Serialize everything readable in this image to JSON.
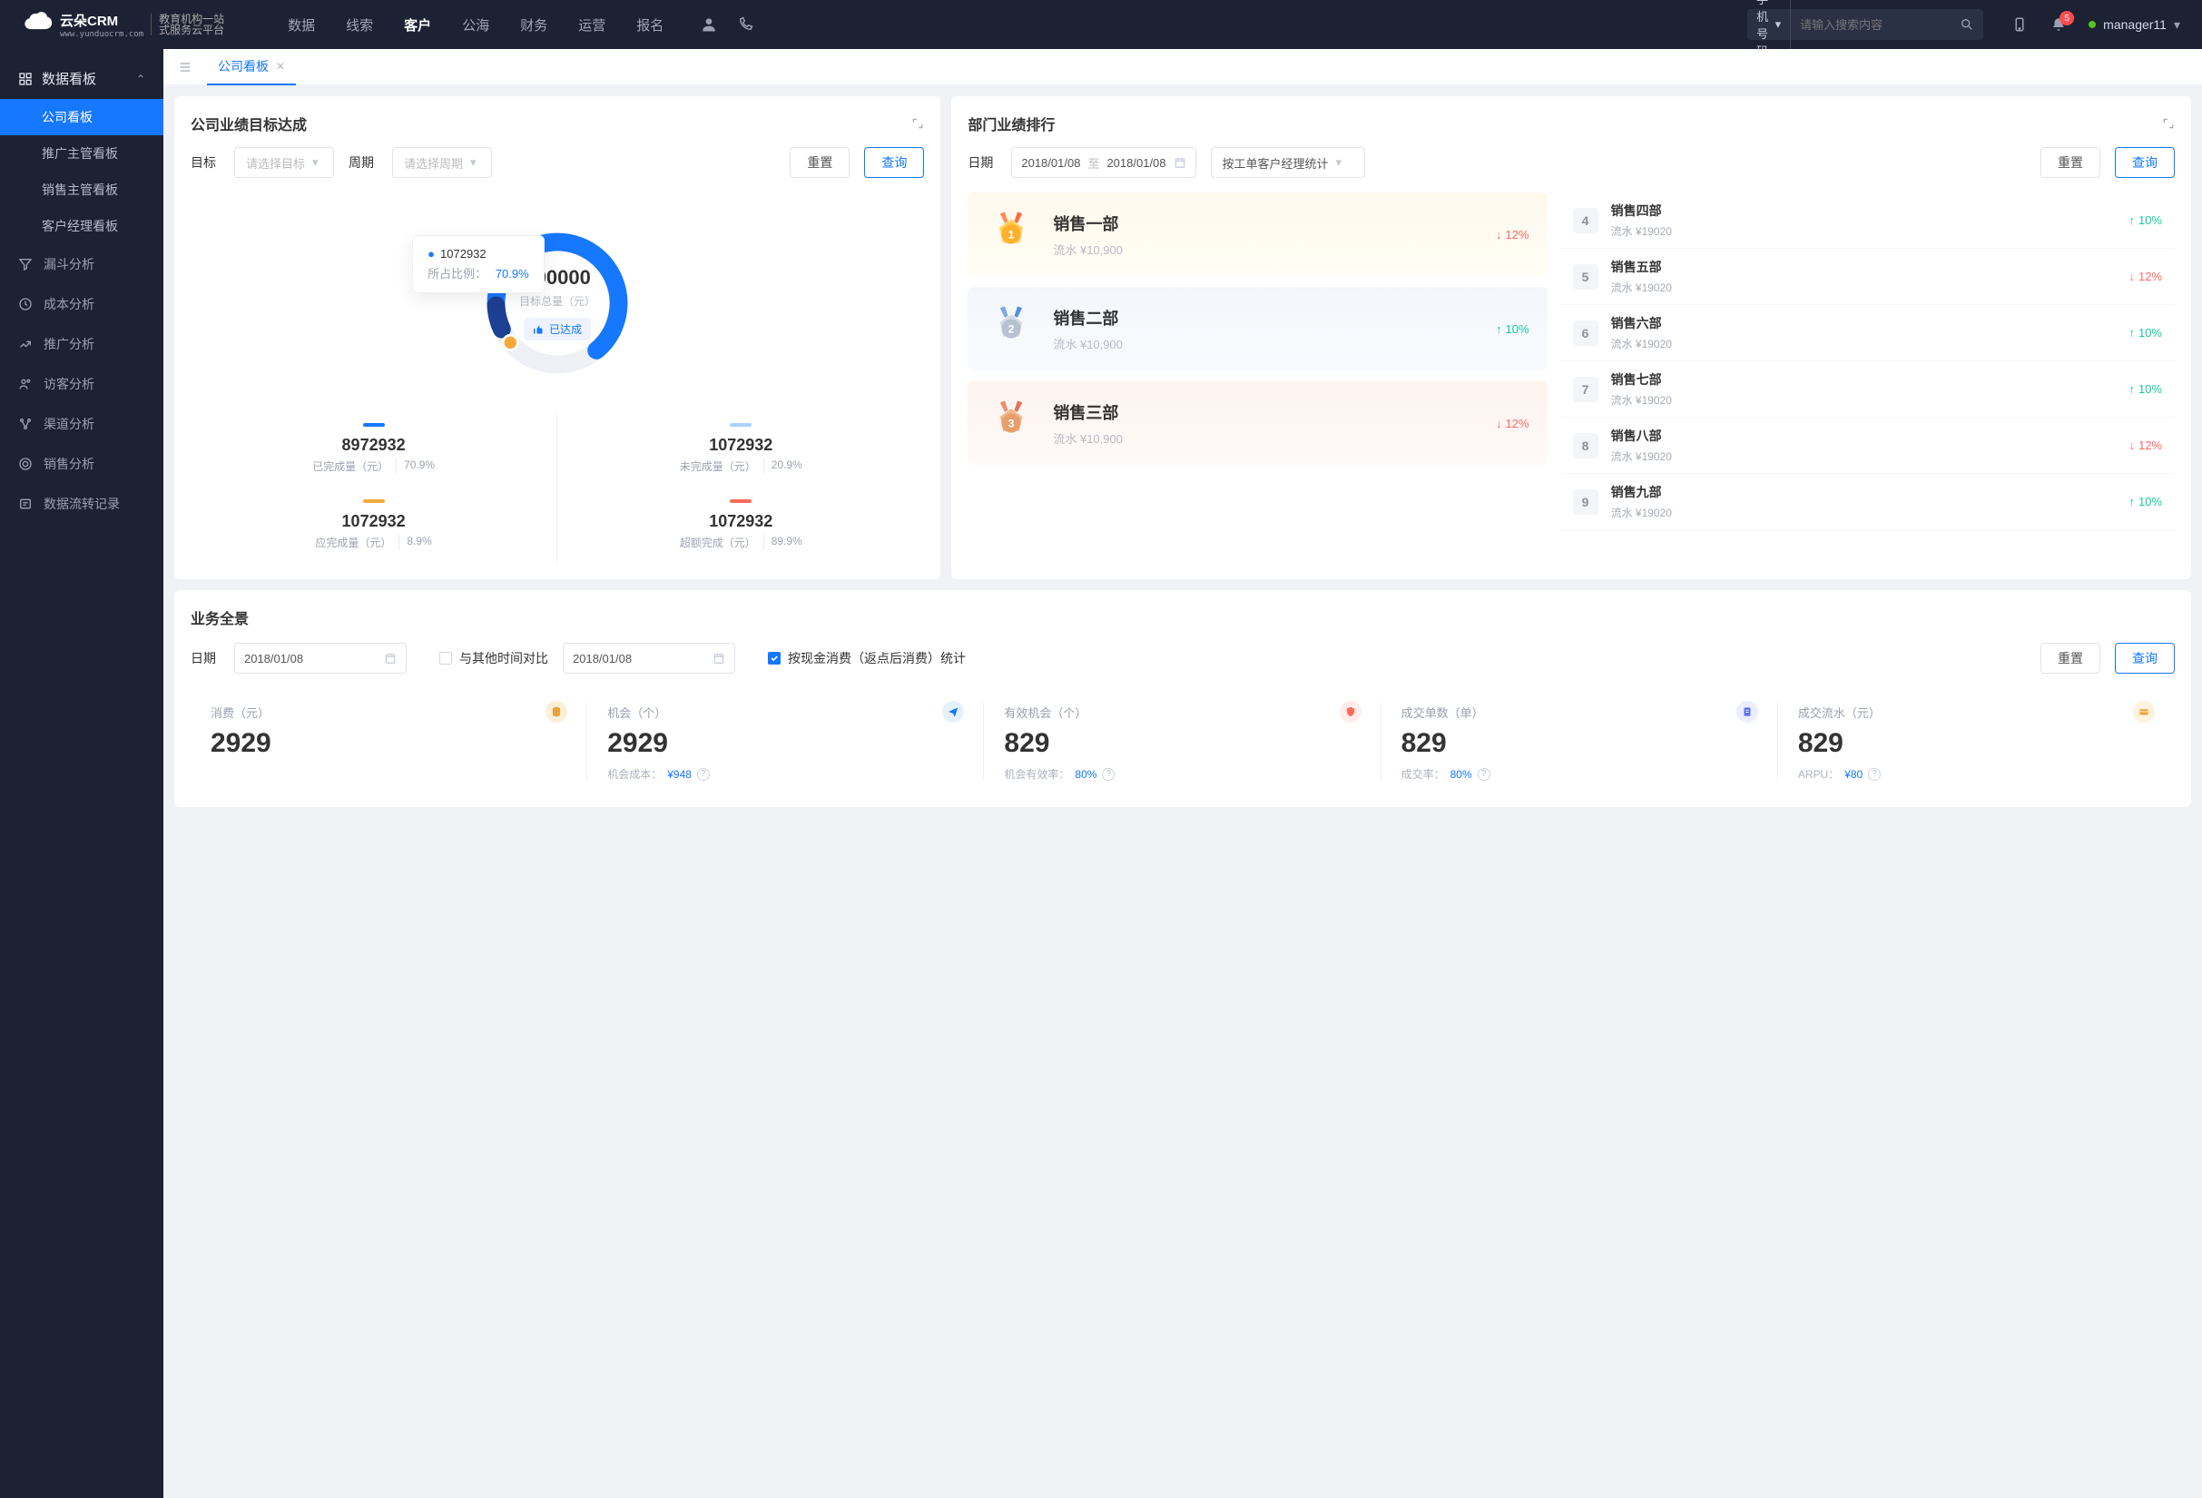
{
  "header": {
    "logo_brand": "云朵CRM",
    "logo_sub_line1": "教育机构一站",
    "logo_sub_line2": "式服务云平台",
    "nav": [
      "数据",
      "线索",
      "客户",
      "公海",
      "财务",
      "运营",
      "报名"
    ],
    "nav_active_index": 2,
    "search_type": "手机号码",
    "search_placeholder": "请输入搜索内容",
    "notif_count": "5",
    "username": "manager11"
  },
  "sidebar": {
    "group_title": "数据看板",
    "subs": [
      "公司看板",
      "推广主管看板",
      "销售主管看板",
      "客户经理看板"
    ],
    "active_sub": 0,
    "items": [
      "漏斗分析",
      "成本分析",
      "推广分析",
      "访客分析",
      "渠道分析",
      "销售分析",
      "数据流转记录"
    ]
  },
  "tabs": {
    "current": "公司看板"
  },
  "card_goal": {
    "title": "公司业绩目标达成",
    "filters": {
      "target_label": "目标",
      "target_placeholder": "请选择目标",
      "period_label": "周期",
      "period_placeholder": "请选择周期",
      "reset": "重置",
      "query": "查询"
    },
    "center_value": "100000",
    "center_label": "目标总量（元）",
    "pill": "已达成",
    "tooltip": {
      "value": "1072932",
      "ratio_label": "所占比例：",
      "ratio": "70.9%"
    },
    "chart_data": {
      "type": "pie",
      "title": "目标总量（元）",
      "total": 100000,
      "segments": [
        {
          "name": "已完成量（元）",
          "value": 8972932,
          "percent": 70.9,
          "color": "#1677ff"
        },
        {
          "name": "未完成量（元）",
          "value": 1072932,
          "percent": 20.9,
          "color": "#a9d1ff"
        },
        {
          "name": "应完成量（元）",
          "value": 1072932,
          "percent": 8.9,
          "color": "#f6a93b"
        },
        {
          "name": "超额完成（元）",
          "value": 1072932,
          "percent": 89.9,
          "color": "#ff6a59"
        }
      ]
    },
    "legend": [
      {
        "color": "#1677ff",
        "value": "8972932",
        "label": "已完成量（元）",
        "pct": "70.9%"
      },
      {
        "color": "#a9d1ff",
        "value": "1072932",
        "label": "未完成量（元）",
        "pct": "20.9%"
      },
      {
        "color": "#f6a93b",
        "value": "1072932",
        "label": "应完成量（元）",
        "pct": "8.9%"
      },
      {
        "color": "#ff6a59",
        "value": "1072932",
        "label": "超额完成（元）",
        "pct": "89.9%"
      }
    ]
  },
  "card_rank": {
    "title": "部门业绩排行",
    "filters": {
      "date_label": "日期",
      "date_from": "2018/01/08",
      "date_sep": "至",
      "date_to": "2018/01/08",
      "group_by": "按工单客户经理统计",
      "reset": "重置",
      "query": "查询"
    },
    "top3": [
      {
        "name": "销售一部",
        "rev": "流水 ¥10,900",
        "trend": "12%",
        "dir": "down"
      },
      {
        "name": "销售二部",
        "rev": "流水 ¥10,900",
        "trend": "10%",
        "dir": "up"
      },
      {
        "name": "销售三部",
        "rev": "流水 ¥10,900",
        "trend": "12%",
        "dir": "down"
      }
    ],
    "rest": [
      {
        "rank": "4",
        "name": "销售四部",
        "rev": "流水 ¥19020",
        "trend": "10%",
        "dir": "up"
      },
      {
        "rank": "5",
        "name": "销售五部",
        "rev": "流水 ¥19020",
        "trend": "12%",
        "dir": "down"
      },
      {
        "rank": "6",
        "name": "销售六部",
        "rev": "流水 ¥19020",
        "trend": "10%",
        "dir": "up"
      },
      {
        "rank": "7",
        "name": "销售七部",
        "rev": "流水 ¥19020",
        "trend": "10%",
        "dir": "up"
      },
      {
        "rank": "8",
        "name": "销售八部",
        "rev": "流水 ¥19020",
        "trend": "12%",
        "dir": "down"
      },
      {
        "rank": "9",
        "name": "销售九部",
        "rev": "流水 ¥19020",
        "trend": "10%",
        "dir": "up"
      }
    ]
  },
  "card_pano": {
    "title": "业务全景",
    "filters": {
      "date_label": "日期",
      "date1": "2018/01/08",
      "compare_label": "与其他时间对比",
      "date2": "2018/01/08",
      "check_label": "按现金消费（返点后消费）统计",
      "reset": "重置",
      "query": "查询"
    },
    "kpis": [
      {
        "label": "消费（元）",
        "value": "2929",
        "sub_label": "",
        "sub_value": "",
        "icon": "coin"
      },
      {
        "label": "机会（个）",
        "value": "2929",
        "sub_label": "机会成本：",
        "sub_value": "¥948",
        "icon": "plane"
      },
      {
        "label": "有效机会（个）",
        "value": "829",
        "sub_label": "机会有效率：",
        "sub_value": "80%",
        "icon": "shield"
      },
      {
        "label": "成交单数（单）",
        "value": "829",
        "sub_label": "成交率：",
        "sub_value": "80%",
        "icon": "doc"
      },
      {
        "label": "成交流水（元）",
        "value": "829",
        "sub_label": "ARPU：",
        "sub_value": "¥80",
        "icon": "card"
      }
    ]
  }
}
